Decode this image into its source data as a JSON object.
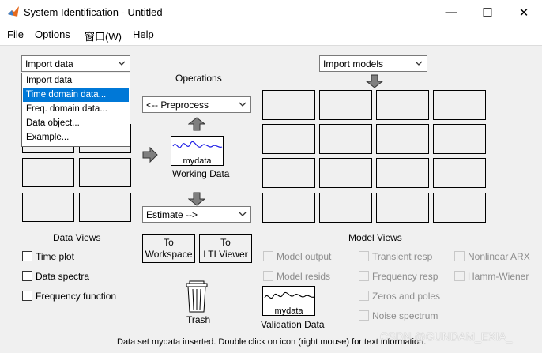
{
  "window": {
    "title": "System Identification - Untitled",
    "minimize_glyph": "—",
    "maximize_glyph": "☐",
    "close_glyph": "✕"
  },
  "menu": [
    "File",
    "Options",
    "窗口(W)",
    "Help"
  ],
  "import_data": {
    "selected": "Import data",
    "options": [
      "Import data",
      "Time domain data...",
      "Freq. domain data...",
      "Data object...",
      "Example..."
    ],
    "highlighted": "Time domain data..."
  },
  "operations": {
    "label": "Operations",
    "preprocess": "<-- Preprocess",
    "estimate": "Estimate -->",
    "working_data_name": "mydata",
    "working_data_label": "Working Data",
    "to_workspace": [
      "To",
      "Workspace"
    ],
    "to_lti_viewer": [
      "To",
      "LTI Viewer"
    ],
    "trash_label": "Trash"
  },
  "import_models": {
    "selected": "Import models"
  },
  "data_views": {
    "title": "Data Views",
    "items": [
      {
        "label": "Time plot",
        "checked": false,
        "enabled": true
      },
      {
        "label": "Data spectra",
        "checked": false,
        "enabled": true
      },
      {
        "label": "Frequency function",
        "checked": false,
        "enabled": true
      }
    ]
  },
  "model_views": {
    "title": "Model Views",
    "col1": [
      {
        "label": "Model output",
        "enabled": false
      },
      {
        "label": "Model resids",
        "enabled": false
      }
    ],
    "col2": [
      {
        "label": "Transient resp",
        "enabled": false
      },
      {
        "label": "Frequency resp",
        "enabled": false
      },
      {
        "label": "Zeros and poles",
        "enabled": false
      },
      {
        "label": "Noise spectrum",
        "enabled": false
      }
    ],
    "col3": [
      {
        "label": "Nonlinear ARX",
        "enabled": false
      },
      {
        "label": "Hamm-Wiener",
        "enabled": false
      }
    ]
  },
  "validation": {
    "name": "mydata",
    "label": "Validation Data"
  },
  "status": "Data set mydata inserted.  Double click on icon (right mouse) for text information.",
  "watermark": "CSDN @GUNDAM_EXIA_",
  "colors": {
    "accent": "#0078d7",
    "signal": "#1e1ee6",
    "background": "#f0f0f0"
  }
}
